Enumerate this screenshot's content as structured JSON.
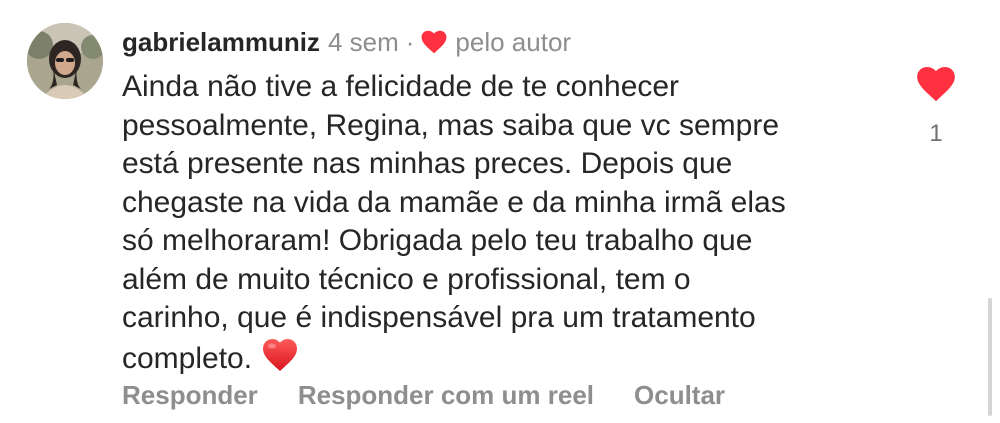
{
  "comment": {
    "username": "gabrielammuniz",
    "time": "4 sem",
    "separator": "·",
    "liked_by_author_label": "pelo autor",
    "text_lines": [
      "Ainda não tive a felicidade de te conhecer",
      "pessoalmente, Regina, mas saiba que vc sempre",
      "está presente nas minhas preces. Depois que",
      "chegaste na vida da mamãe e da minha irmã elas",
      "só melhoraram! Obrigada pelo teu trabalho que",
      "além de muito técnico e profissional, tem o",
      "carinho, que é indispensável pra um tratamento",
      "completo."
    ],
    "emoji": "red-heart-emoji",
    "like_icon": "heart-filled-icon",
    "like_count": "1"
  },
  "actions": {
    "reply": "Responder",
    "reply_with_reel": "Responder com um reel",
    "hide": "Ocultar"
  },
  "colors": {
    "text": "#262626",
    "secondary": "#8e8e8e",
    "like_red": "#ff3040"
  }
}
